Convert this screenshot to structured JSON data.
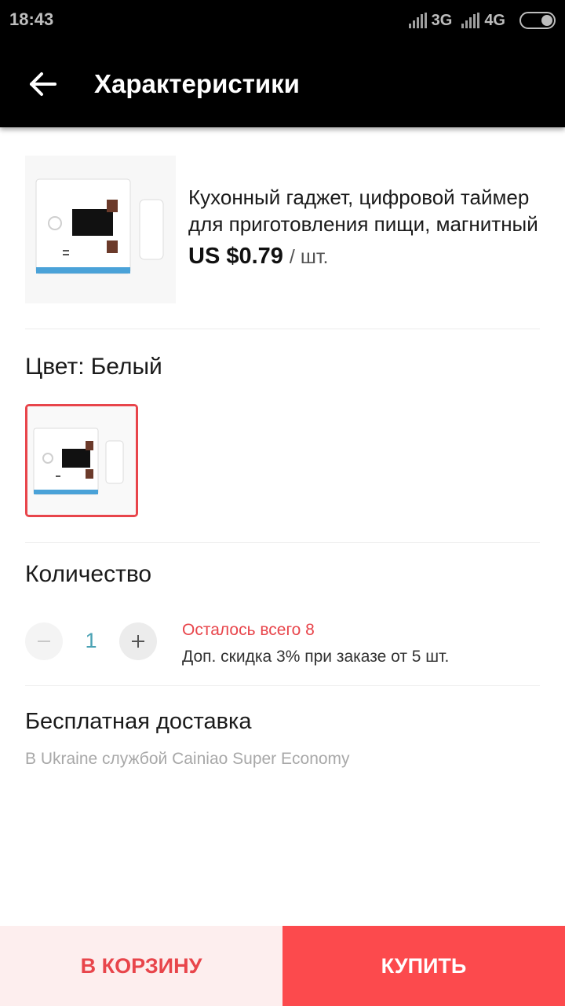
{
  "status_bar": {
    "time": "18:43",
    "network_1": "3G",
    "network_2": "4G"
  },
  "app_bar": {
    "title": "Характеристики",
    "back_icon": "arrow-left-icon"
  },
  "product": {
    "title": "Кухонный гаджет, цифровой таймер для приготовления пищи, магнитный",
    "price": "US $0.79",
    "unit": "/ шт.",
    "image_icon": "kitchen-timer-photo"
  },
  "color": {
    "label": "Цвет:",
    "value": "Белый",
    "selected_border": "#e8454b"
  },
  "quantity": {
    "label": "Количество",
    "value": "1",
    "minus_symbol": "−",
    "plus_symbol": "+",
    "stock_note": "Осталось всего 8",
    "discount_note": "Доп. скидка 3% при заказе от 5 шт."
  },
  "shipping": {
    "title": "Бесплатная доставка",
    "description": "В Ukraine службой Cainiao Super Economy"
  },
  "actions": {
    "add_to_cart": "В КОРЗИНУ",
    "buy": "КУПИТЬ"
  },
  "colors": {
    "accent": "#fc4a4d",
    "accent_light": "#fdeeee",
    "quantity_text": "#4aa2b4"
  }
}
